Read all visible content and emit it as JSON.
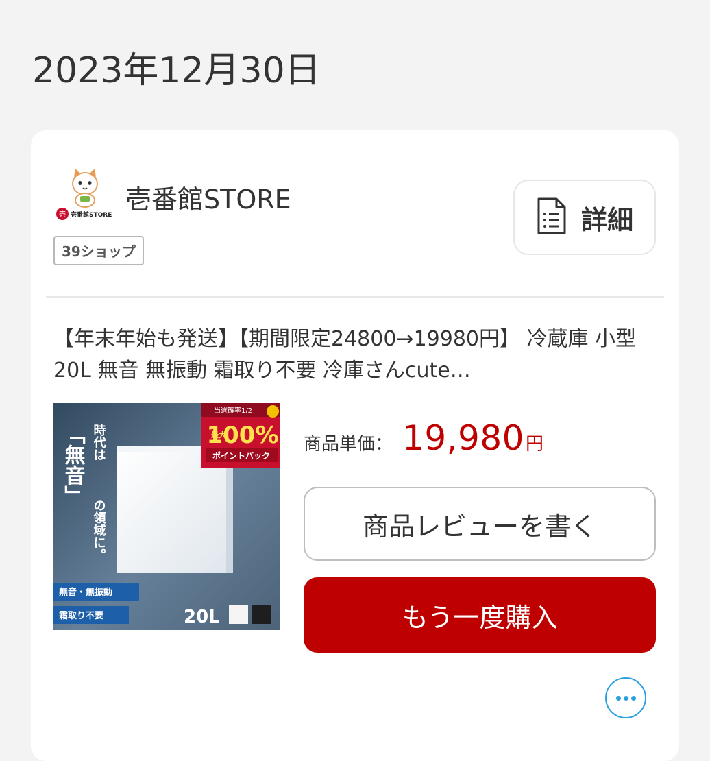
{
  "order_date": "2023年12月30日",
  "shop": {
    "name": "壱番館STORE",
    "tag": "39ショップ",
    "logo_text": "壱番館STORE",
    "logo_mark": "壱"
  },
  "detail_button": {
    "label": "詳細",
    "icon": "document-icon"
  },
  "product": {
    "title": "【年末年始も発送】【期間限定24800→19980円】 冷蔵庫 小型 20L 無音 無振動 霜取り不要 冷庫さんcute…",
    "image": {
      "badge_top": "当選確率1/2",
      "badge_small": "最大",
      "badge_main": "100%",
      "badge_sub": "ポイントバック",
      "vertical_line1": "時代は",
      "vertical_line2": "「無音」",
      "vertical_line3": "の領域に。",
      "feature1": "無音・無振動",
      "feature2": "霜取り不要",
      "capacity": "20L"
    },
    "price_label": "商品単価：",
    "price_value": "19,980",
    "price_unit": "円"
  },
  "actions": {
    "review_label": "商品レビューを書く",
    "rebuy_label": "もう一度購入",
    "more_icon": "more-icon"
  },
  "colors": {
    "accent_red": "#bf0000",
    "link_blue": "#2aa0e0",
    "background": "#f3f3f3"
  }
}
